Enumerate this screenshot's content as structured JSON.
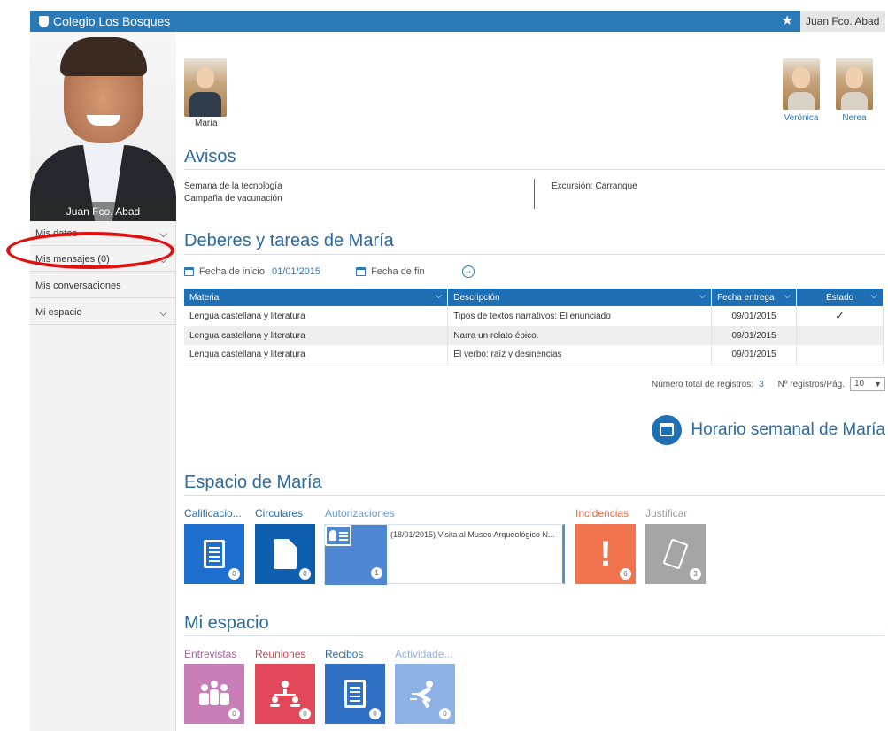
{
  "app": {
    "school_name": "Colegio Los Bosques",
    "user_name": "Juan Fco. Abad"
  },
  "sidebar": {
    "profile_caption": "Juan Fco. Abad",
    "items": [
      {
        "label": "Mis datos"
      },
      {
        "label": "Mis mensajes (0)"
      },
      {
        "label": "Mis conversaciones"
      },
      {
        "label": "Mi espacio"
      }
    ]
  },
  "children": {
    "active": "María",
    "others": [
      "Verónica",
      "Nerea"
    ]
  },
  "avisos": {
    "title": "Avisos",
    "left": [
      "Semana de la tecnología",
      "Campaña de vacunación"
    ],
    "right": [
      "Excursión: Carranque"
    ]
  },
  "deberes": {
    "title": "Deberes y tareas de María",
    "start_label": "Fecha de inicio",
    "start_value": "01/01/2015",
    "end_label": "Fecha de fin",
    "columns": [
      "Materia",
      "Descripción",
      "Fecha entrega",
      "Estado"
    ],
    "rows": [
      {
        "materia": "Lengua castellana y literatura",
        "descripcion": "Tipos de textos narrativos: El enunciado",
        "fecha": "09/01/2015",
        "estado": "✓"
      },
      {
        "materia": "Lengua castellana y literatura",
        "descripcion": "Narra un relato épico.",
        "fecha": "09/01/2015",
        "estado": ""
      },
      {
        "materia": "Lengua castellana y literatura",
        "descripcion": "El verbo: raíz y desinencias",
        "fecha": "09/01/2015",
        "estado": ""
      }
    ],
    "total_label": "Número total de registros:",
    "total_value": "3",
    "per_page_label": "Nº registros/Pág.",
    "per_page_value": "10"
  },
  "horario": {
    "label": "Horario semanal de María"
  },
  "espacio": {
    "title": "Espacio de María",
    "tiles": [
      {
        "label": "Calificacio...",
        "count": "0",
        "color": "#1f6fd1",
        "label_color": "#2a6aa0"
      },
      {
        "label": "Circulares",
        "count": "0",
        "color": "#0f5fb0",
        "label_color": "#2a6aa0"
      },
      {
        "label": "Autorizaciones",
        "count": "1",
        "color": "#4f87d4",
        "label_color": "#6a9ccc",
        "detail": "(18/01/2015) Visita al Museo Arqueológico N..."
      },
      {
        "label": "Incidencias",
        "count": "6",
        "color": "#f2744e",
        "label_color": "#e06b48"
      },
      {
        "label": "Justificar",
        "count": "3",
        "color": "#a5a5a5",
        "label_color": "#9a9a9a"
      }
    ]
  },
  "mi_espacio": {
    "title": "Mi espacio",
    "tiles": [
      {
        "label": "Entrevistas",
        "count": "0",
        "color": "#c87fb8",
        "label_color": "#b05aa0"
      },
      {
        "label": "Reuniones",
        "count": "0",
        "color": "#e2475a",
        "label_color": "#d0475a"
      },
      {
        "label": "Recibos",
        "count": "0",
        "color": "#2f6fc4",
        "label_color": "#2a6aa0"
      },
      {
        "label": "Actividade...",
        "count": "0",
        "color": "#8fb2e6",
        "label_color": "#8fb2e6"
      }
    ]
  }
}
